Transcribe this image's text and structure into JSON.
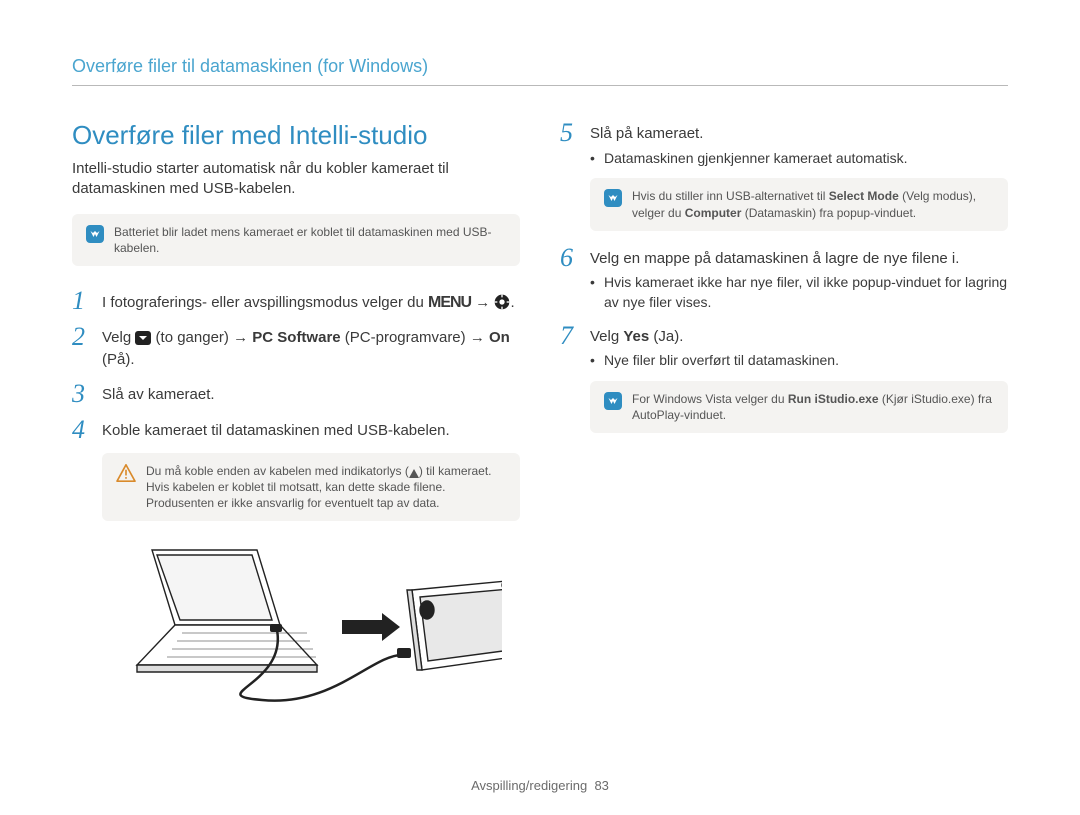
{
  "breadcrumb": "Overføre filer til datamaskinen (for Windows)",
  "section_title": "Overføre filer med Intelli-studio",
  "intro": "Intelli-studio starter automatisk når du kobler kameraet til datamaskinen med USB-kabelen.",
  "note_battery": "Batteriet blir ladet mens kameraet er koblet til datamaskinen med USB-kabelen.",
  "steps": {
    "s1_a": "I fotograferings- eller avspillingsmodus velger du ",
    "s1_b": " → ",
    "s1_c": ".",
    "s2_a": "Velg ",
    "s2_b": " (to ganger) → ",
    "s2_bold1": "PC Software",
    "s2_c": " (PC-programvare) → ",
    "s2_bold2": "On",
    "s2_d": " (På).",
    "s3": "Slå av kameraet.",
    "s4": "Koble kameraet til datamaskinen med USB-kabelen.",
    "s5": "Slå på kameraet.",
    "s5_sub": "Datamaskinen gjenkjenner kameraet automatisk.",
    "s6": "Velg en mappe på datamaskinen å lagre de nye filene i.",
    "s6_sub": "Hvis kameraet ikke har nye filer, vil ikke popup-vinduet for lagring av nye filer vises.",
    "s7_a": "Velg ",
    "s7_bold": "Yes",
    "s7_b": " (Ja).",
    "s7_sub": "Nye filer blir overført til datamaskinen."
  },
  "note_cable_a": "Du må koble enden av kabelen med indikatorlys (",
  "note_cable_b": ") til kameraet. Hvis kabelen er koblet til motsatt, kan dette skade filene. Produsenten er ikke ansvarlig for eventuelt tap av data.",
  "note_select_a": "Hvis du stiller inn USB-alternativet til ",
  "note_select_bold1": "Select Mode",
  "note_select_b": " (Velg modus), velger du ",
  "note_select_bold2": "Computer",
  "note_select_c": " (Datamaskin) fra popup-vinduet.",
  "note_vista_a": "For Windows Vista velger du ",
  "note_vista_bold": "Run iStudio.exe",
  "note_vista_b": " (Kjør iStudio.exe) fra AutoPlay-vinduet.",
  "footer_section": "Avspilling/redigering",
  "footer_page": "83",
  "num": {
    "n1": "1",
    "n2": "2",
    "n3": "3",
    "n4": "4",
    "n5": "5",
    "n6": "6",
    "n7": "7"
  },
  "glyph_menu": "MENU"
}
